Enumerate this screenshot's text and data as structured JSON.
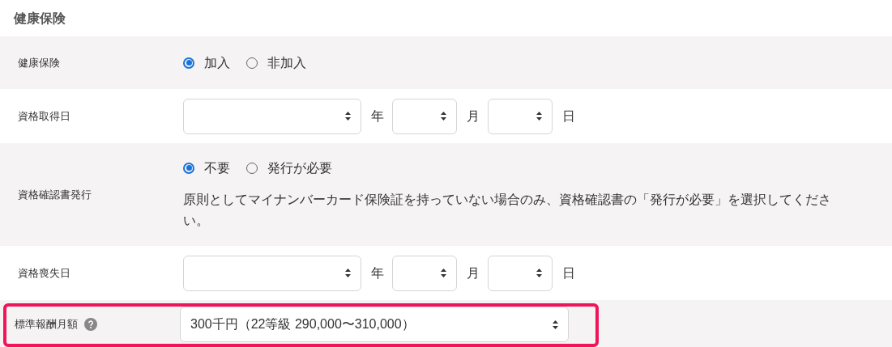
{
  "section_title": "健康保険",
  "rows": [
    {
      "kind": "radio",
      "label": "健康保険",
      "options": [
        {
          "label": "加入",
          "selected": true
        },
        {
          "label": "非加入",
          "selected": false
        }
      ]
    },
    {
      "kind": "date",
      "label": "資格取得日",
      "units": [
        "年",
        "月",
        "日"
      ]
    },
    {
      "kind": "radio_note",
      "label": "資格確認書発行",
      "options": [
        {
          "label": "不要",
          "selected": true
        },
        {
          "label": "発行が必要",
          "selected": false
        }
      ],
      "note": "原則としてマイナンバーカード保険証を持っていない場合のみ、資格確認書の「発行が必要」を選択してください。"
    },
    {
      "kind": "date",
      "label": "資格喪失日",
      "units": [
        "年",
        "月",
        "日"
      ]
    },
    {
      "kind": "select",
      "label": "標準報酬月額",
      "help": true,
      "highlighted": true,
      "value": "300千円（22等級 290,000〜310,000）"
    }
  ]
}
